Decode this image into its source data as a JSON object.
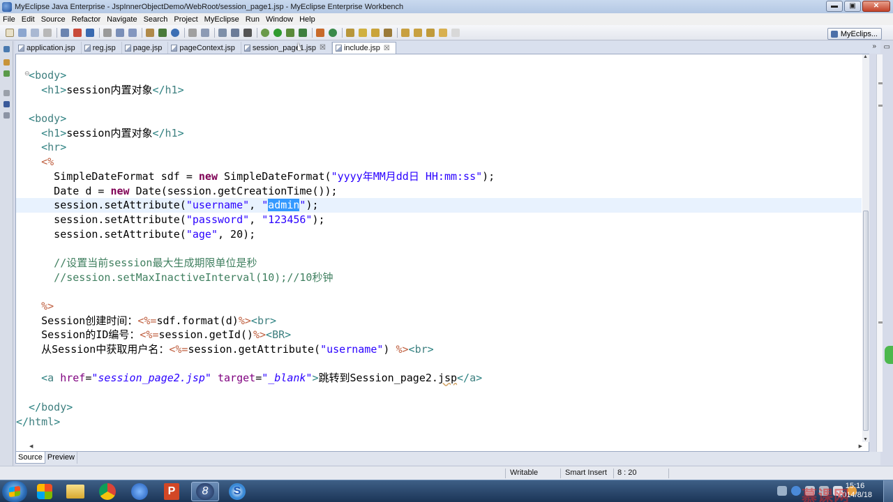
{
  "window": {
    "title": "MyEclipse Java Enterprise - JspInnerObjectDemo/WebRoot/session_page1.jsp - MyEclipse Enterprise Workbench",
    "min": "▬",
    "max": "▣",
    "close": "✕"
  },
  "menu": [
    "File",
    "Edit",
    "Source",
    "Refactor",
    "Navigate",
    "Search",
    "Project",
    "MyEclipse",
    "Run",
    "Window",
    "Help"
  ],
  "perspective": {
    "label": "MyEclips..."
  },
  "tabs": [
    {
      "label": "application.jsp",
      "active": false
    },
    {
      "label": "reg.jsp",
      "active": false
    },
    {
      "label": "page.jsp",
      "active": false
    },
    {
      "label": "pageContext.jsp",
      "active": false
    },
    {
      "label": "session_page1.jsp",
      "active": false,
      "close": "☒"
    },
    {
      "label": "include.jsp",
      "active": true,
      "close": "☒"
    }
  ],
  "tab_overflow": "»",
  "tab_minimize": "▭",
  "editor": {
    "fold_marker": "⊖",
    "lines": [
      [
        [
          "tag",
          "  <"
        ],
        [
          "el",
          "body"
        ],
        [
          "tag",
          ">"
        ]
      ],
      [
        [
          "tag",
          "    <"
        ],
        [
          "el",
          "h1"
        ],
        [
          "tag",
          ">"
        ],
        [
          "text",
          "session内置对象"
        ],
        [
          "tag",
          "</"
        ],
        [
          "el",
          "h1"
        ],
        [
          "tag",
          ">"
        ]
      ],
      [],
      [
        [
          "tag",
          "  <"
        ],
        [
          "el",
          "body"
        ],
        [
          "tag",
          ">"
        ]
      ],
      [
        [
          "tag",
          "    <"
        ],
        [
          "el",
          "h1"
        ],
        [
          "tag",
          ">"
        ],
        [
          "text",
          "session内置对象"
        ],
        [
          "tag",
          "</"
        ],
        [
          "el",
          "h1"
        ],
        [
          "tag",
          ">"
        ]
      ],
      [
        [
          "tag",
          "    <"
        ],
        [
          "el",
          "hr"
        ],
        [
          "tag",
          ">"
        ]
      ],
      [
        [
          "delim",
          "    <%"
        ]
      ],
      [
        [
          "plain",
          "      SimpleDateFormat sdf = "
        ],
        [
          "kw",
          "new"
        ],
        [
          "plain",
          " SimpleDateFormat("
        ],
        [
          "str",
          "\"yyyy年MM月dd日 HH:mm:ss\""
        ],
        [
          "plain",
          ");"
        ]
      ],
      [
        [
          "plain",
          "      Date d = "
        ],
        [
          "kw",
          "new"
        ],
        [
          "plain",
          " Date(session.getCreationTime());"
        ]
      ],
      [
        [
          "plain",
          "      session.setAttribute("
        ],
        [
          "str",
          "\"username\""
        ],
        [
          "plain",
          ", "
        ],
        [
          "str",
          "\""
        ],
        [
          "sel",
          "admin"
        ],
        [
          "str",
          "\""
        ],
        [
          "plain",
          ");"
        ]
      ],
      [
        [
          "plain",
          "      session.setAttribute("
        ],
        [
          "str",
          "\"password\""
        ],
        [
          "plain",
          ", "
        ],
        [
          "str",
          "\"123456\""
        ],
        [
          "plain",
          ");"
        ]
      ],
      [
        [
          "plain",
          "      session.setAttribute("
        ],
        [
          "str",
          "\"age\""
        ],
        [
          "plain",
          ", 20);"
        ]
      ],
      [],
      [
        [
          "cm",
          "      //设置当前session最大生成期限单位是秒"
        ]
      ],
      [
        [
          "cm",
          "      //session.setMaxInactiveInterval(10);//10秒钟"
        ]
      ],
      [],
      [
        [
          "delim",
          "    %>"
        ]
      ],
      [
        [
          "text",
          "    Session创建时间："
        ],
        [
          "delim",
          "<%="
        ],
        [
          "plain",
          "sdf.format(d)"
        ],
        [
          "delim",
          "%>"
        ],
        [
          "tag",
          "<"
        ],
        [
          "el",
          "br"
        ],
        [
          "tag",
          ">"
        ]
      ],
      [
        [
          "text",
          "    Session的ID编号："
        ],
        [
          "delim",
          "<%="
        ],
        [
          "plain",
          "session.getId()"
        ],
        [
          "delim",
          "%>"
        ],
        [
          "tag",
          "<"
        ],
        [
          "el",
          "BR"
        ],
        [
          "tag",
          ">"
        ]
      ],
      [
        [
          "text",
          "    从Session中获取用户名："
        ],
        [
          "delim",
          "<%="
        ],
        [
          "plain",
          "session.getAttribute("
        ],
        [
          "str",
          "\"username\""
        ],
        [
          "plain",
          ") "
        ],
        [
          "delim",
          "%>"
        ],
        [
          "tag",
          "<"
        ],
        [
          "el",
          "br"
        ],
        [
          "tag",
          ">"
        ]
      ],
      [],
      [
        [
          "tag",
          "    <"
        ],
        [
          "el",
          "a "
        ],
        [
          "attr",
          "href"
        ],
        [
          "plain",
          "="
        ],
        [
          "istr",
          "\"session_page2.jsp\""
        ],
        [
          "plain",
          " "
        ],
        [
          "attr",
          "target"
        ],
        [
          "plain",
          "="
        ],
        [
          "istr",
          "\"_blank\""
        ],
        [
          "tag",
          ">"
        ],
        [
          "text",
          "跳转到Session_page2."
        ],
        [
          "squig",
          "jsp"
        ],
        [
          "tag",
          "</"
        ],
        [
          "el",
          "a"
        ],
        [
          "tag",
          ">"
        ]
      ],
      [],
      [
        [
          "tag",
          "  </"
        ],
        [
          "el",
          "body"
        ],
        [
          "tag",
          ">"
        ]
      ],
      [
        [
          "tag",
          "</"
        ],
        [
          "el",
          "html"
        ],
        [
          "tag",
          ">"
        ]
      ]
    ],
    "current_line": 9
  },
  "source_tabs": [
    {
      "label": "Source",
      "active": true
    },
    {
      "label": "Preview",
      "active": false
    }
  ],
  "status": {
    "writable": "Writable",
    "insert_mode": "Smart Insert",
    "position": "8 : 20"
  },
  "taskbar": {
    "time": "15:16",
    "date": "2014/8/18",
    "watermark": "慕课网"
  },
  "colors": {
    "selection": "#3399ff",
    "keyword": "#7f0055",
    "string": "#2a00ff",
    "comment": "#3f7f5f",
    "current_line": "#e8f2fe"
  }
}
